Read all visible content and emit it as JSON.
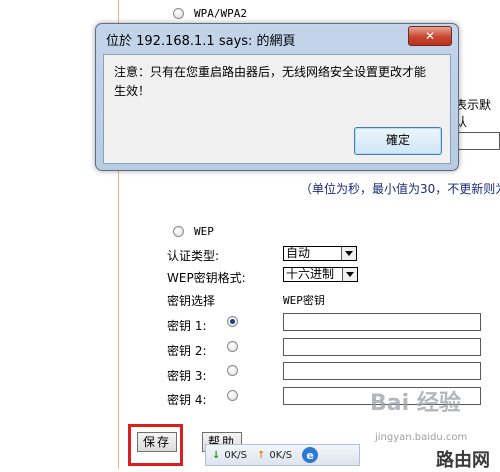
{
  "background_form": {
    "wpa_option": "WPA/WPA2",
    "note_right_fragment": "表示默认",
    "interval_note": "（单位为秒，最小值为30，不更新则为",
    "wep_option": "WEP",
    "auth_type_label": "认证类型:",
    "auth_type_value": "自动",
    "key_format_label": "WEP密钥格式:",
    "key_format_value": "十六进制",
    "key_select_label": "密钥选择",
    "wep_key_header": "WEP密钥",
    "keys": [
      {
        "label": "密钥 1:"
      },
      {
        "label": "密钥 2:"
      },
      {
        "label": "密钥 3:"
      },
      {
        "label": "密钥 4:"
      }
    ],
    "save_button": "保存",
    "help_button": "帮助"
  },
  "dialog": {
    "title": "位於 192.168.1.1 says: 的網頁",
    "message": "注意：只有在您重启路由器后，无线网络安全设置更改才能生效！",
    "ok_button": "確定",
    "close_icon": "close-icon"
  },
  "statusbar": {
    "download": "0K/S",
    "upload": "0K/S"
  },
  "watermark": {
    "brand": "Bai 经验",
    "site": "jingyan.baidu.com",
    "corner": "路由网"
  },
  "colors": {
    "dialog_frame": "#c4d5ea",
    "close_button": "#c8472f",
    "highlight": "#d9201c"
  }
}
